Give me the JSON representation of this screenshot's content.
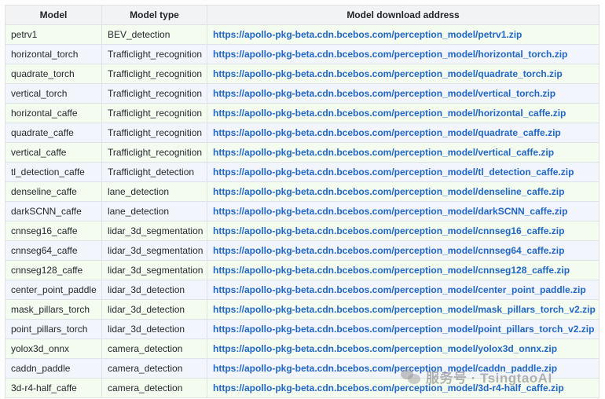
{
  "table": {
    "headers": [
      "Model",
      "Model type",
      "Model download address"
    ],
    "rows": [
      [
        "petrv1",
        "BEV_detection",
        "https://apollo-pkg-beta.cdn.bcebos.com/perception_model/petrv1.zip"
      ],
      [
        "horizontal_torch",
        "Trafficlight_recognition",
        "https://apollo-pkg-beta.cdn.bcebos.com/perception_model/horizontal_torch.zip"
      ],
      [
        "quadrate_torch",
        "Trafficlight_recognition",
        "https://apollo-pkg-beta.cdn.bcebos.com/perception_model/quadrate_torch.zip"
      ],
      [
        "vertical_torch",
        "Trafficlight_recognition",
        "https://apollo-pkg-beta.cdn.bcebos.com/perception_model/vertical_torch.zip"
      ],
      [
        "horizontal_caffe",
        "Trafficlight_recognition",
        "https://apollo-pkg-beta.cdn.bcebos.com/perception_model/horizontal_caffe.zip"
      ],
      [
        "quadrate_caffe",
        "Trafficlight_recognition",
        "https://apollo-pkg-beta.cdn.bcebos.com/perception_model/quadrate_caffe.zip"
      ],
      [
        "vertical_caffe",
        "Trafficlight_recognition",
        "https://apollo-pkg-beta.cdn.bcebos.com/perception_model/vertical_caffe.zip"
      ],
      [
        "tl_detection_caffe",
        "Trafficlight_detection",
        "https://apollo-pkg-beta.cdn.bcebos.com/perception_model/tl_detection_caffe.zip"
      ],
      [
        "denseline_caffe",
        "lane_detection",
        "https://apollo-pkg-beta.cdn.bcebos.com/perception_model/denseline_caffe.zip"
      ],
      [
        "darkSCNN_caffe",
        "lane_detection",
        "https://apollo-pkg-beta.cdn.bcebos.com/perception_model/darkSCNN_caffe.zip"
      ],
      [
        "cnnseg16_caffe",
        "lidar_3d_segmentation",
        "https://apollo-pkg-beta.cdn.bcebos.com/perception_model/cnnseg16_caffe.zip"
      ],
      [
        "cnnseg64_caffe",
        "lidar_3d_segmentation",
        "https://apollo-pkg-beta.cdn.bcebos.com/perception_model/cnnseg64_caffe.zip"
      ],
      [
        "cnnseg128_caffe",
        "lidar_3d_segmentation",
        "https://apollo-pkg-beta.cdn.bcebos.com/perception_model/cnnseg128_caffe.zip"
      ],
      [
        "center_point_paddle",
        "lidar_3d_detection",
        "https://apollo-pkg-beta.cdn.bcebos.com/perception_model/center_point_paddle.zip"
      ],
      [
        "mask_pillars_torch",
        "lidar_3d_detection",
        "https://apollo-pkg-beta.cdn.bcebos.com/perception_model/mask_pillars_torch_v2.zip"
      ],
      [
        "point_pillars_torch",
        "lidar_3d_detection",
        "https://apollo-pkg-beta.cdn.bcebos.com/perception_model/point_pillars_torch_v2.zip"
      ],
      [
        "yolox3d_onnx",
        "camera_detection",
        "https://apollo-pkg-beta.cdn.bcebos.com/perception_model/yolox3d_onnx.zip"
      ],
      [
        "caddn_paddle",
        "camera_detection",
        "https://apollo-pkg-beta.cdn.bcebos.com/perception_model/caddn_paddle.zip"
      ],
      [
        "3d-r4-half_caffe",
        "camera_detection",
        "https://apollo-pkg-beta.cdn.bcebos.com/perception_model/3d-r4-half_caffe.zip"
      ]
    ]
  },
  "watermark": {
    "text": "服务号 · TsingtaoAI",
    "icon": "wechat-logo-icon"
  },
  "colors": {
    "link": "#2167c6",
    "row_odd": "#f4fbef",
    "row_even": "#f2f5fc",
    "header_bg": "#f2f3f5",
    "border": "#dfe2e5"
  }
}
